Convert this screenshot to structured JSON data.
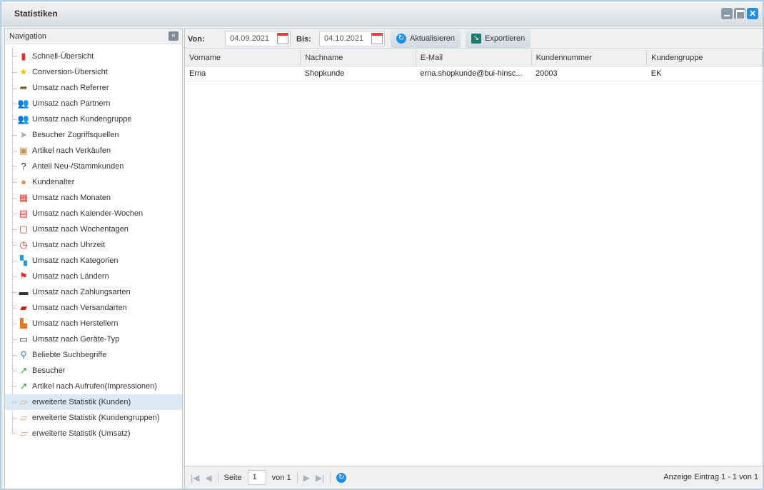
{
  "window": {
    "title": "Statistiken",
    "buttons": [
      "minimize",
      "maximize",
      "close"
    ]
  },
  "nav": {
    "title": "Navigation",
    "selected_index": 22,
    "items": [
      {
        "label": "Schnell-Übersicht",
        "icon": "bar-chart-icon"
      },
      {
        "label": "Conversion-Übersicht",
        "icon": "star-icon"
      },
      {
        "label": "Umsatz nach Referrer",
        "icon": "arrow-forward-icon"
      },
      {
        "label": "Umsatz nach Partnern",
        "icon": "users-icon"
      },
      {
        "label": "Umsatz nach Kundengruppe",
        "icon": "user-group-icon"
      },
      {
        "label": "Besucher Zugriffsquellen",
        "icon": "cursor-icon"
      },
      {
        "label": "Artikel nach Verkäufen",
        "icon": "box-icon"
      },
      {
        "label": "Anteil Neu-/Stammkunden",
        "icon": "user-question-icon"
      },
      {
        "label": "Kundenalter",
        "icon": "user-icon"
      },
      {
        "label": "Umsatz nach Monaten",
        "icon": "calendar-month-icon"
      },
      {
        "label": "Umsatz nach Kalender-Wochen",
        "icon": "calendar-week-icon"
      },
      {
        "label": "Umsatz nach Wochentagen",
        "icon": "calendar-day-icon"
      },
      {
        "label": "Umsatz nach Uhrzeit",
        "icon": "clock-icon"
      },
      {
        "label": "Umsatz nach Kategorien",
        "icon": "category-tree-icon"
      },
      {
        "label": "Umsatz nach Ländern",
        "icon": "flag-icon"
      },
      {
        "label": "Umsatz nach Zahlungsarten",
        "icon": "credit-card-icon"
      },
      {
        "label": "Umsatz nach Versandarten",
        "icon": "truck-icon"
      },
      {
        "label": "Umsatz nach Herstellern",
        "icon": "factory-icon"
      },
      {
        "label": "Umsatz nach Geräte-Typ",
        "icon": "devices-icon"
      },
      {
        "label": "Beliebte Suchbegriffe",
        "icon": "magnifier-icon"
      },
      {
        "label": "Besucher",
        "icon": "trend-up-icon"
      },
      {
        "label": "Artikel nach Aufrufen(Impressionen)",
        "icon": "trend-bars-icon"
      },
      {
        "label": "erweiterte Statistik (Kunden)",
        "icon": "ruler-icon"
      },
      {
        "label": "erweiterte Statistik (Kundengruppen)",
        "icon": "ruler-icon"
      },
      {
        "label": "erweiterte Statistik (Umsatz)",
        "icon": "ruler-icon"
      }
    ]
  },
  "toolbar": {
    "from_label": "Von:",
    "from_value": "04.09.2021",
    "to_label": "Bis:",
    "to_value": "04.10.2021",
    "refresh_label": "Aktualisieren",
    "export_label": "Exportieren"
  },
  "grid": {
    "columns": [
      "Vorname",
      "Nachname",
      "E-Mail",
      "Kundennummer",
      "Kundengruppe"
    ],
    "rows": [
      [
        "Erna",
        "Shopkunde",
        "erna.shopkunde@bui-hinsc...",
        "20003",
        "EK"
      ]
    ]
  },
  "pager": {
    "page_label": "Seite",
    "page": "1",
    "of_label": "von 1",
    "status": "Anzeige Eintrag 1 - 1 von 1"
  }
}
